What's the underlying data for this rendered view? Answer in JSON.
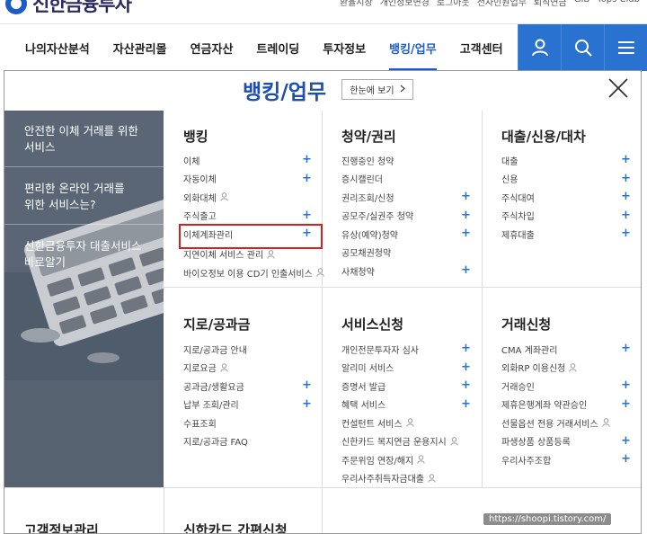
{
  "topbar": {
    "logo_text": "신한금융투자",
    "util_links": [
      "환율시장",
      "개인정보변경",
      "로그아웃",
      "전자민원업무",
      "퇴직연금",
      "GIB",
      "Tops Club"
    ]
  },
  "nav": {
    "items": [
      {
        "label": "나의자산분석"
      },
      {
        "label": "자산관리몰"
      },
      {
        "label": "연금자산"
      },
      {
        "label": "트레이딩"
      },
      {
        "label": "투자정보"
      },
      {
        "label": "뱅킹/업무"
      },
      {
        "label": "고객센터"
      }
    ],
    "active_index": 5,
    "icons": [
      "user-icon",
      "search-icon",
      "menu-icon"
    ]
  },
  "panel": {
    "title": "뱅킹/업무",
    "view_button": "한눈에 보기",
    "view_button_icon": "chevron-right-icon",
    "close_icon": "close-icon"
  },
  "side": {
    "items": [
      {
        "line1": "안전한 이체 거래를 위한",
        "line2": "서비스"
      },
      {
        "line1": "편리한 온라인 거래를",
        "line2": "위한 서비스는?"
      },
      {
        "line1": "신한금융투자 대출서비스",
        "line2": "바로알기"
      }
    ]
  },
  "sections": {
    "banking": {
      "title": "뱅킹",
      "items": [
        {
          "label": "이체",
          "plus": true,
          "person": false
        },
        {
          "label": "자동이체",
          "plus": true,
          "person": false
        },
        {
          "label": "외화대체",
          "plus": false,
          "person": true
        },
        {
          "label": "주식출고",
          "plus": true,
          "person": false
        },
        {
          "label": "이체계좌관리",
          "plus": true,
          "person": false
        },
        {
          "label": "지연이체 서비스 관리",
          "plus": false,
          "person": true
        },
        {
          "label": "바이오정보 이용 CD기 인출서비스",
          "plus": false,
          "person": true
        }
      ]
    },
    "subscription": {
      "title": "청약/권리",
      "items": [
        {
          "label": "진행중인 청약",
          "plus": false,
          "person": false
        },
        {
          "label": "증시캘린더",
          "plus": false,
          "person": false
        },
        {
          "label": "권리조회/신청",
          "plus": true,
          "person": false
        },
        {
          "label": "공모주/실권주 청약",
          "plus": true,
          "person": false
        },
        {
          "label": "유상(예약)청약",
          "plus": true,
          "person": false
        },
        {
          "label": "공모채권청약",
          "plus": false,
          "person": false
        },
        {
          "label": "사채청약",
          "plus": true,
          "person": false
        }
      ]
    },
    "loan": {
      "title": "대출/신용/대차",
      "items": [
        {
          "label": "대출",
          "plus": true,
          "person": false
        },
        {
          "label": "신용",
          "plus": true,
          "person": false
        },
        {
          "label": "주식대여",
          "plus": true,
          "person": false
        },
        {
          "label": "주식차입",
          "plus": true,
          "person": false
        },
        {
          "label": "제휴대출",
          "plus": true,
          "person": false
        }
      ]
    },
    "giro": {
      "title": "지로/공과금",
      "items": [
        {
          "label": "지로/공과금 안내",
          "plus": false,
          "person": false
        },
        {
          "label": "지로요금",
          "plus": false,
          "person": true
        },
        {
          "label": "공과금/생활요금",
          "plus": true,
          "person": false
        },
        {
          "label": "납부 조회/관리",
          "plus": true,
          "person": false
        },
        {
          "label": "수표조회",
          "plus": false,
          "person": false
        },
        {
          "label": "지로/공과금 FAQ",
          "plus": false,
          "person": false
        }
      ]
    },
    "service": {
      "title": "서비스신청",
      "items": [
        {
          "label": "개인전문투자자 심사",
          "plus": true,
          "person": false
        },
        {
          "label": "알리미 서비스",
          "plus": true,
          "person": false
        },
        {
          "label": "증명서 발급",
          "plus": true,
          "person": false
        },
        {
          "label": "혜택 서비스",
          "plus": true,
          "person": false
        },
        {
          "label": "컨설턴트 서비스",
          "plus": false,
          "person": true
        },
        {
          "label": "신한카드 복지연금 운용지시",
          "plus": false,
          "person": true
        },
        {
          "label": "주문위임 연장/해지",
          "plus": false,
          "person": true
        },
        {
          "label": "우리사주취득자금대출",
          "plus": false,
          "person": true
        }
      ]
    },
    "trade": {
      "title": "거래신청",
      "items": [
        {
          "label": "CMA 계좌관리",
          "plus": true,
          "person": false
        },
        {
          "label": "외화RP 이용신청",
          "plus": false,
          "person": true
        },
        {
          "label": "거래승인",
          "plus": true,
          "person": false
        },
        {
          "label": "제휴은행계좌 약관승인",
          "plus": true,
          "person": false
        },
        {
          "label": "선물옵션 전용 거래서비스",
          "plus": false,
          "person": true
        },
        {
          "label": "파생상품 상품등록",
          "plus": true,
          "person": false
        },
        {
          "label": "우리사주조합",
          "plus": true,
          "person": false
        }
      ]
    }
  },
  "bottom": {
    "left_title": "고객정보관리",
    "mid_title": "신한카드 간편신청"
  },
  "watermark": "https://shoopi.tistory.com/",
  "colors": {
    "accent": "#1f5ec8",
    "nav_icon_bg": "#2a72cf",
    "plus": "#2a72cf",
    "highlight": "#d32020",
    "side_bg": "#4d5a6a"
  }
}
